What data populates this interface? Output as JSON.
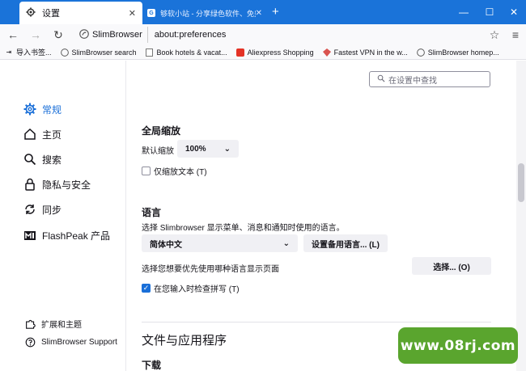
{
  "tabs": [
    {
      "title": "设置",
      "icon": "gear-icon"
    },
    {
      "title": "够软小站 - 分享绿色软件、免费...",
      "icon": "site-favicon-icon"
    }
  ],
  "nav": {
    "identity_label": "SlimBrowser",
    "url": "about:preferences"
  },
  "bookmarks": [
    {
      "label": "导入书签...",
      "icon": "import-icon"
    },
    {
      "label": "SlimBrowser search",
      "icon": "slimbrowser-icon"
    },
    {
      "label": "Book hotels & vacat...",
      "icon": "page-icon"
    },
    {
      "label": "Aliexpress Shopping",
      "icon": "aliexpress-icon"
    },
    {
      "label": "Fastest VPN in the w...",
      "icon": "vpn-icon"
    },
    {
      "label": "SlimBrowser homep...",
      "icon": "slimbrowser-icon"
    }
  ],
  "sidebar": {
    "categories": [
      {
        "label": "常规",
        "icon": "gear-icon",
        "active": true
      },
      {
        "label": "主页",
        "icon": "home-icon",
        "active": false
      },
      {
        "label": "搜索",
        "icon": "search-icon",
        "active": false
      },
      {
        "label": "隐私与安全",
        "icon": "lock-icon",
        "active": false
      },
      {
        "label": "同步",
        "icon": "sync-icon",
        "active": false
      },
      {
        "label": "FlashPeak 产品",
        "icon": "flashpeak-logo-icon",
        "active": false
      }
    ],
    "footer": [
      {
        "label": "扩展和主题",
        "icon": "puzzle-icon"
      },
      {
        "label": "SlimBrowser Support",
        "icon": "help-icon"
      }
    ]
  },
  "search": {
    "placeholder": "在设置中查找"
  },
  "zoom": {
    "heading": "全局缩放",
    "default_label": "默认缩放",
    "value": "100%",
    "text_only_label": "仅缩放文本 (T)",
    "text_only_checked": false
  },
  "language": {
    "heading": "语言",
    "description": "选择 Slimbrowser 显示菜单、消息和通知时使用的语言。",
    "selected": "简体中文",
    "alt_button": "设置备用语言... (L)",
    "page_lang_label": "选择您想要优先使用哪种语言显示页面",
    "choose_button": "选择... (O)",
    "spellcheck_label": "在您输入时检查拼写 (T)",
    "spellcheck_checked": true
  },
  "files": {
    "heading": "文件与应用程序",
    "download_heading": "下载"
  },
  "watermark": {
    "text": "www.08rj.com"
  },
  "colors": {
    "accent": "#1a6fd8",
    "titlebar": "#1a73d9",
    "watermark_bg": "#5aa52e"
  }
}
